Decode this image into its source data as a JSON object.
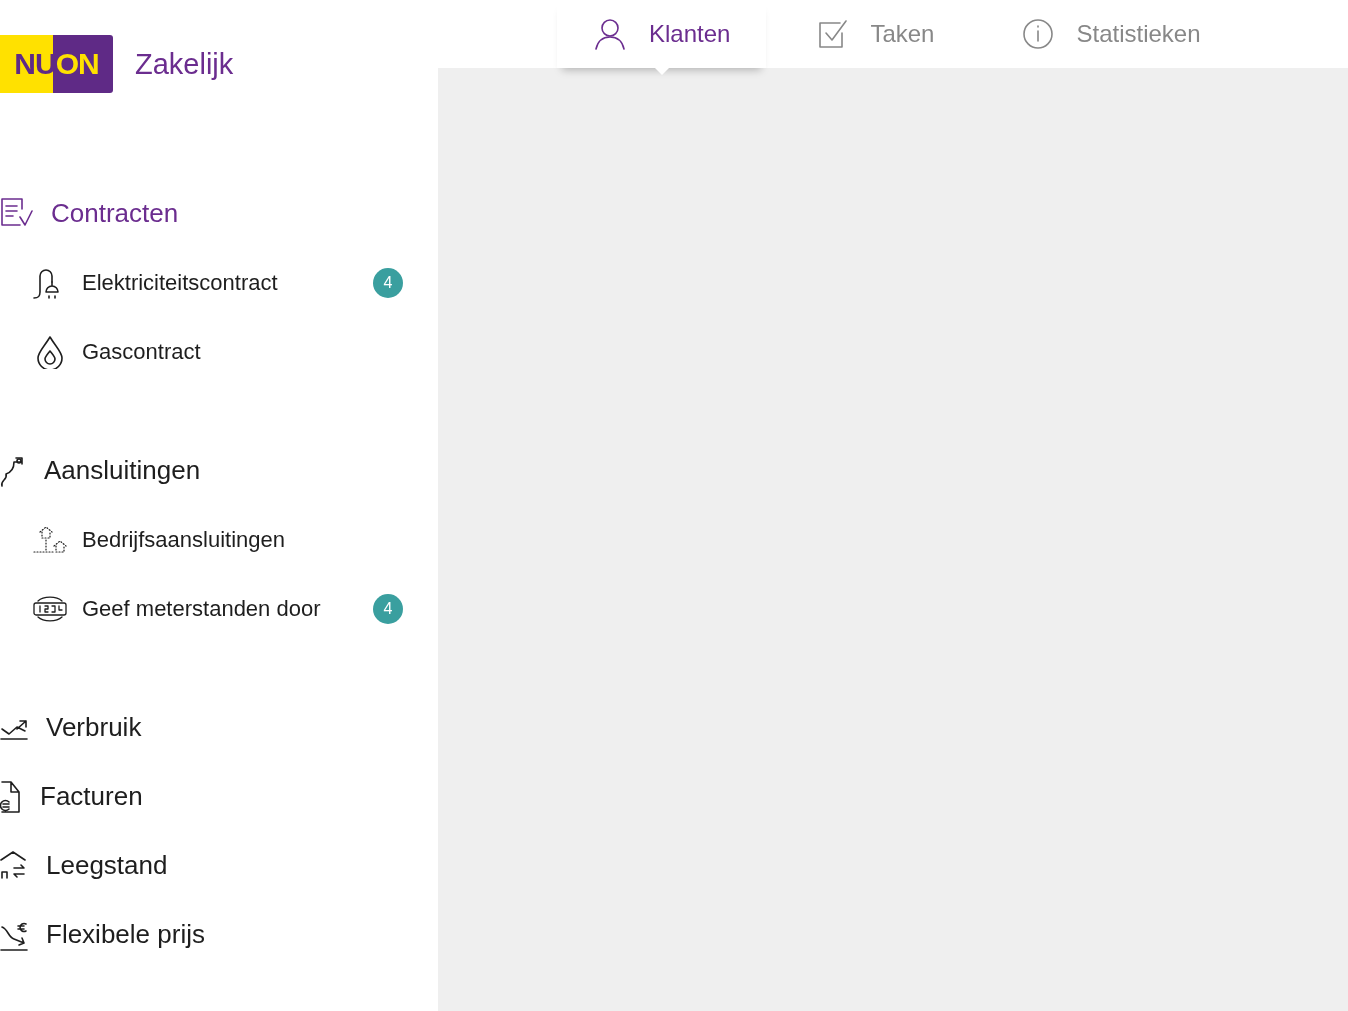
{
  "logo": {
    "mark": "NUON",
    "title": "Zakelijk"
  },
  "tabs": [
    {
      "label": "Klanten",
      "selected": true
    },
    {
      "label": "Taken",
      "selected": false
    },
    {
      "label": "Statistieken",
      "selected": false
    }
  ],
  "sidebar": {
    "groups": [
      {
        "items": [
          {
            "label": "Contracten",
            "selected": true,
            "children": [
              {
                "label": "Elektriciteitscontract",
                "badge": "4"
              },
              {
                "label": "Gascontract"
              }
            ]
          }
        ]
      },
      {
        "items": [
          {
            "label": "Aansluitingen",
            "selected": false,
            "children": [
              {
                "label": "Bedrijfsaansluitingen"
              },
              {
                "label": "Geef meterstanden door",
                "badge": "4"
              }
            ]
          }
        ]
      },
      {
        "items": [
          {
            "label": "Verbruik",
            "selected": false
          },
          {
            "label": "Facturen",
            "selected": false
          },
          {
            "label": "Leegstand",
            "selected": false
          },
          {
            "label": "Flexibele prijs",
            "selected": false
          }
        ]
      }
    ]
  }
}
